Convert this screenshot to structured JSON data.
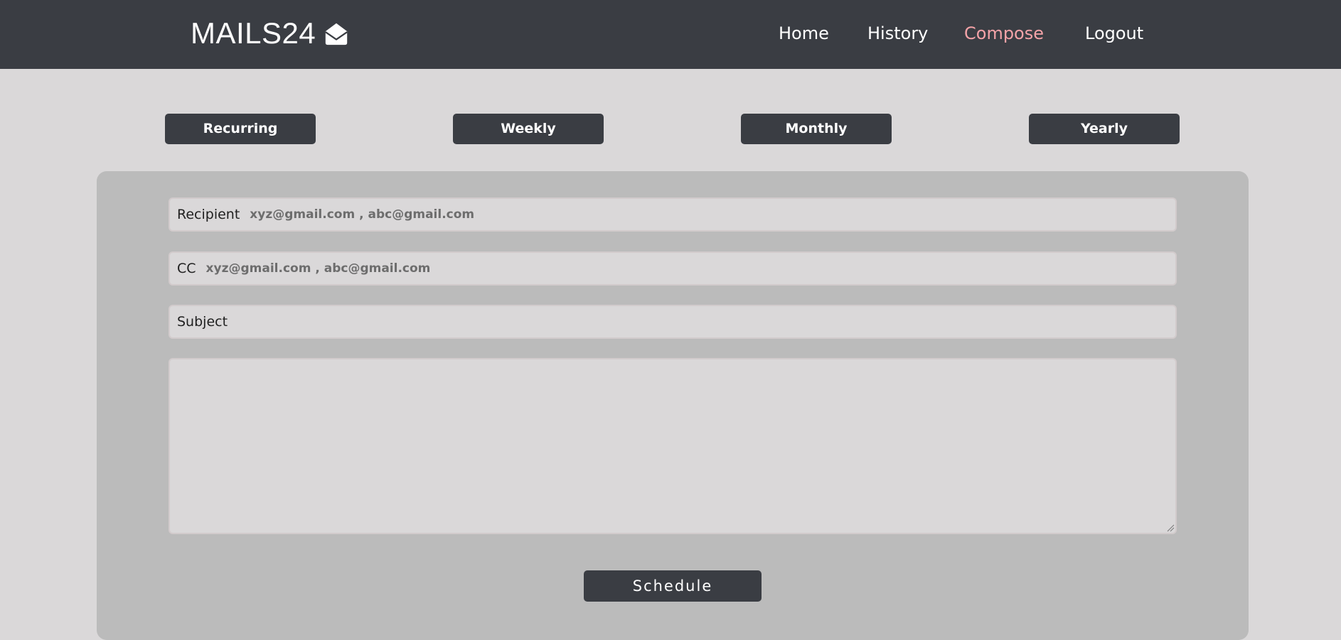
{
  "header": {
    "brand": "MAILS24",
    "brand_icon": "envelope-open-icon",
    "nav": {
      "home": "Home",
      "history": "History",
      "compose": "Compose",
      "logout": "Logout",
      "active_color": "#f4a3a8"
    }
  },
  "tabs": {
    "recurring": "Recurring",
    "weekly": "Weekly",
    "monthly": "Monthly",
    "yearly": "Yearly"
  },
  "form": {
    "recipient_label": "Recipient",
    "recipient_placeholder": "xyz@gmail.com , abc@gmail.com",
    "cc_label": "CC",
    "cc_placeholder": "xyz@gmail.com , abc@gmail.com",
    "subject_label": "Subject",
    "subject_value": "",
    "body_value": "",
    "schedule_label": "Schedule"
  },
  "colors": {
    "navbar": "#3a3d43",
    "page_bg": "#dad8d9",
    "panel_bg": "#bbbbbb"
  }
}
